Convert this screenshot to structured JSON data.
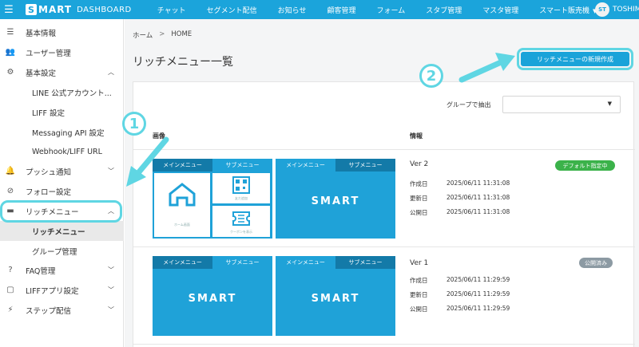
{
  "app": {
    "brand": "MART",
    "brand_mark": "S",
    "brand_sub": "DASHBOARD",
    "menu_icon": "hamburger-icon"
  },
  "topnav": {
    "items": [
      "チャット",
      "セグメント配信",
      "お知らせ",
      "顧客管理",
      "フォーム",
      "スタブ管理",
      "マスタ管理",
      "スマート販売機"
    ],
    "user_initials": "ST",
    "user_name": "TOSHIM"
  },
  "sidebar": {
    "items": [
      {
        "label": "基本情報",
        "icon": "list-icon"
      },
      {
        "label": "ユーザー管理",
        "icon": "users-icon"
      },
      {
        "label": "基本設定",
        "icon": "gear-icon"
      },
      {
        "label": "LINE 公式アカウント...",
        "icon": ""
      },
      {
        "label": "LIFF 設定",
        "icon": ""
      },
      {
        "label": "Messaging API 設定",
        "icon": ""
      },
      {
        "label": "Webhook/LIFF URL",
        "icon": ""
      },
      {
        "label": "プッシュ通知",
        "icon": "bell-icon"
      },
      {
        "label": "フォロー設定",
        "icon": "link-icon"
      },
      {
        "label": "リッチメニュー",
        "icon": "richmenu-icon"
      },
      {
        "label": "リッチメニュー",
        "icon": ""
      },
      {
        "label": "グループ管理",
        "icon": ""
      },
      {
        "label": "FAQ管理",
        "icon": "question-icon"
      },
      {
        "label": "LIFFアプリ設定",
        "icon": "app-icon"
      },
      {
        "label": "ステップ配信",
        "icon": "step-icon"
      }
    ]
  },
  "breadcrumb": {
    "home": "ホーム",
    "sep": ">",
    "current": "HOME"
  },
  "page": {
    "title": "リッチメニュー一覧",
    "create_button": "リッチメニューの新規作成",
    "filter_label": "グループで抽出",
    "filter_value": "",
    "col_image": "画像",
    "col_info": "情報"
  },
  "menus": [
    {
      "version": "Ver 2",
      "badge": "デフォルト指定中",
      "created_label": "作成日",
      "created": "2025/06/11 11:31:08",
      "updated_label": "更新日",
      "updated": "2025/06/11 11:31:08",
      "published_label": "公開日",
      "published": "2025/06/11 11:31:08",
      "main_tab": "メインメニュー",
      "sub_tab": "サブメニュー",
      "tile_home": "ホーム画面",
      "tile_qr": "友だ追加",
      "tile_coupon": "クーポンを表示",
      "logo": "MART"
    },
    {
      "version": "Ver 1",
      "badge": "公開済み",
      "created_label": "作成日",
      "created": "2025/06/11 11:29:59",
      "updated_label": "更新日",
      "updated": "2025/06/11 11:29:59",
      "published_label": "公開日",
      "published": "2025/06/11 11:29:59",
      "main_tab": "メインメニュー",
      "sub_tab": "サブメニュー",
      "logo": "MART"
    }
  ],
  "annotations": {
    "step1": "1",
    "step2": "2"
  },
  "colors": {
    "brand": "#1ba4db",
    "accent": "#5fd6e3",
    "badge_default": "#3bb24a",
    "badge_public": "#8c9aa3"
  }
}
